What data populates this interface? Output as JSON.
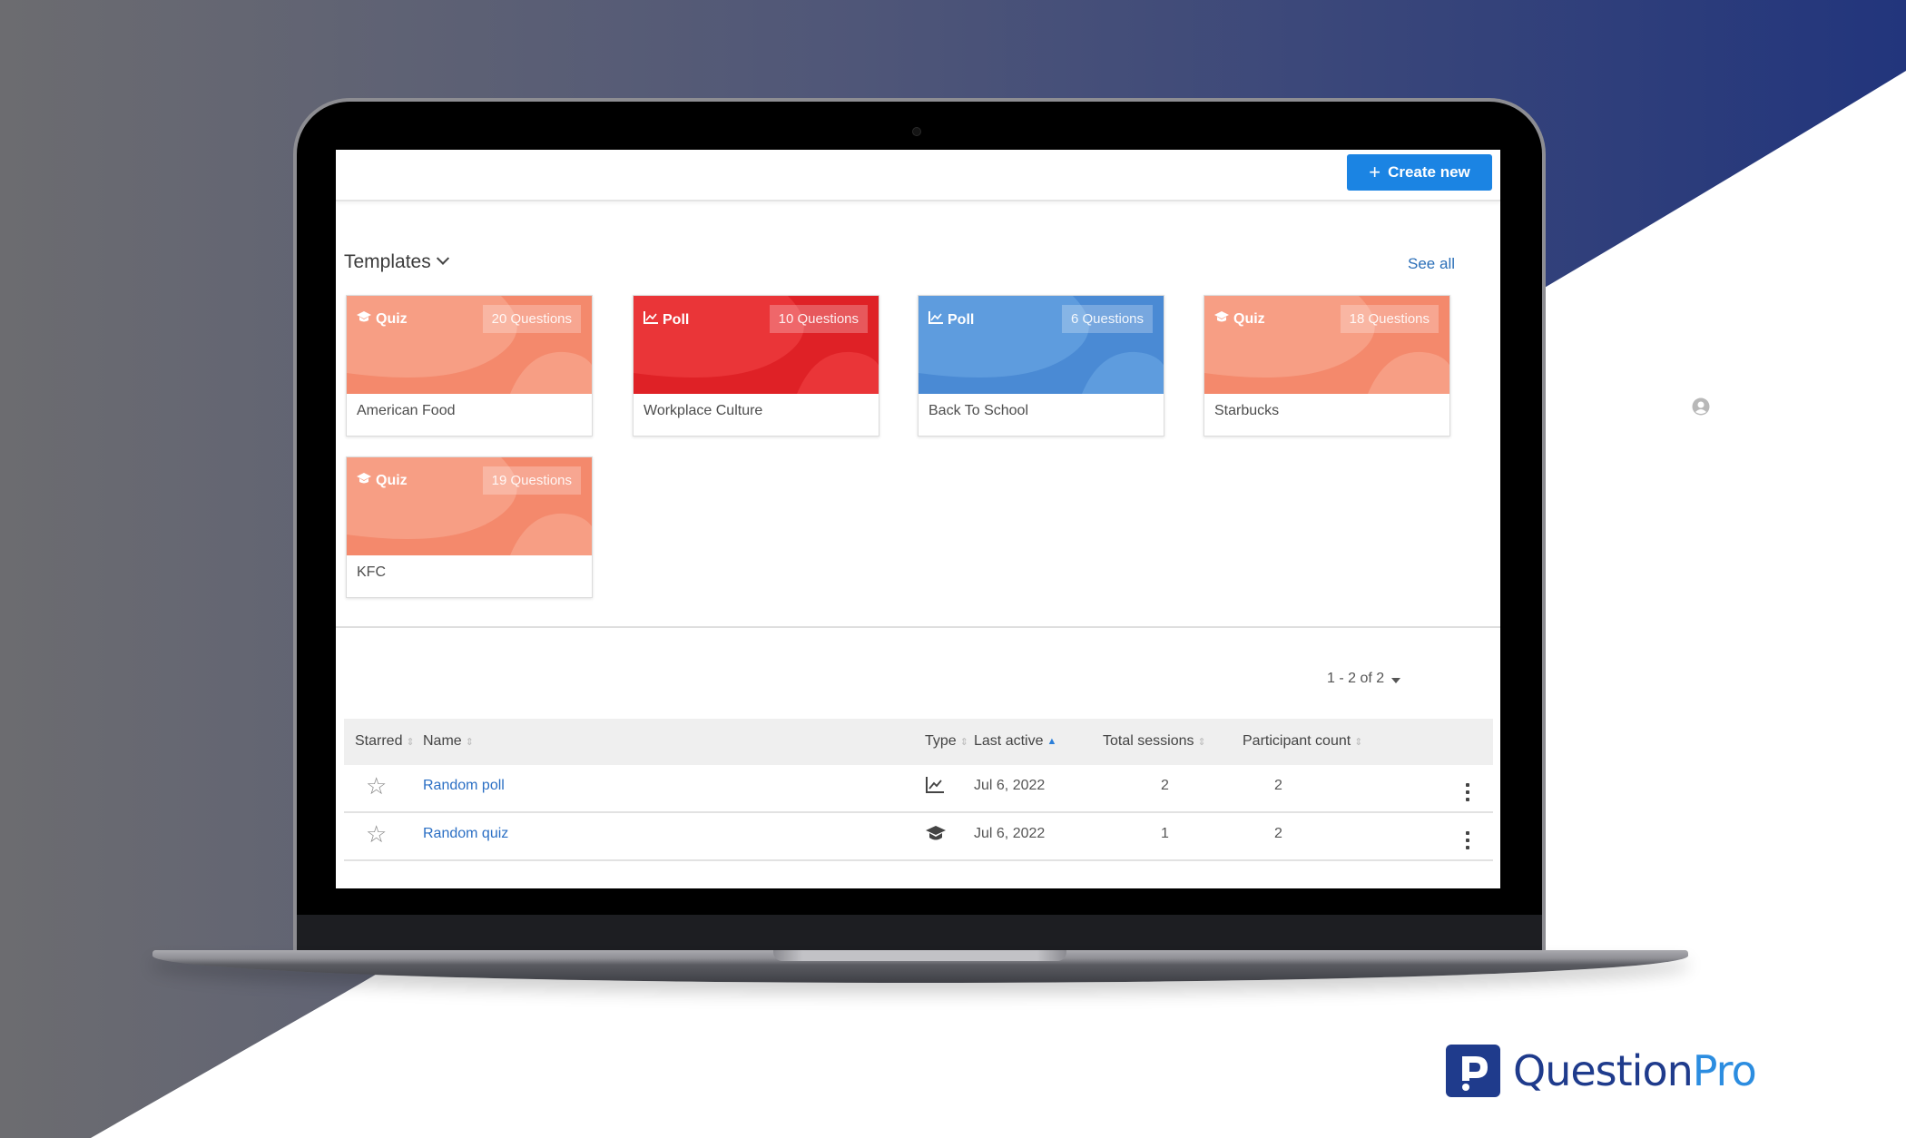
{
  "header": {
    "create_button_label": "Create new",
    "create_button_icon": "plus-icon"
  },
  "templates": {
    "heading": "Templates",
    "heading_icon": "chevron-down-icon",
    "see_all_label": "See all",
    "cards": [
      {
        "type": "Quiz",
        "type_icon": "graduation-cap-icon",
        "questions": "20 Questions",
        "title": "American Food",
        "color": "#f4896c",
        "color_light": "#f7a48b"
      },
      {
        "type": "Poll",
        "type_icon": "chart-line-icon",
        "questions": "10 Questions",
        "title": "Workplace Culture",
        "color": "#df2126",
        "color_light": "#ec3b3d"
      },
      {
        "type": "Poll",
        "type_icon": "chart-line-icon",
        "questions": "6 Questions",
        "title": "Back To School",
        "color": "#4a8ad4",
        "color_light": "#63a0e0"
      },
      {
        "type": "Quiz",
        "type_icon": "graduation-cap-icon",
        "questions": "18 Questions",
        "title": "Starbucks",
        "color": "#f4896c",
        "color_light": "#f7a48b"
      },
      {
        "type": "Quiz",
        "type_icon": "graduation-cap-icon",
        "questions": "19 Questions",
        "title": "KFC",
        "color": "#f4896c",
        "color_light": "#f7a48b"
      }
    ]
  },
  "pagination": {
    "label": "1 - 2 of 2"
  },
  "table": {
    "columns": [
      {
        "label": "Starred",
        "sort": "none"
      },
      {
        "label": "Name",
        "sort": "none"
      },
      {
        "label": "Type",
        "sort": "none"
      },
      {
        "label": "Last active",
        "sort": "ascending"
      },
      {
        "label": "Total sessions",
        "sort": "none"
      },
      {
        "label": "Participant count",
        "sort": "none"
      }
    ],
    "rows": [
      {
        "starred": false,
        "name": "Random poll",
        "type": "Poll",
        "type_icon": "chart-line-icon",
        "last_active": "Jul 6, 2022",
        "total_sessions": "2",
        "participant_count": "2"
      },
      {
        "starred": false,
        "name": "Random quiz",
        "type": "Quiz",
        "type_icon": "graduation-cap-icon",
        "last_active": "Jul 6, 2022",
        "total_sessions": "1",
        "participant_count": "2"
      }
    ]
  },
  "branding": {
    "logo_word_1": "Question",
    "logo_word_2": "Pro",
    "primary_color": "#1f3b8c",
    "accent_color": "#2c8de0"
  },
  "colors": {
    "button_blue": "#1b84e3",
    "link_blue": "#2b6fc4",
    "bg_navy": "#283a7c",
    "bg_gray": "#6a6a70"
  }
}
